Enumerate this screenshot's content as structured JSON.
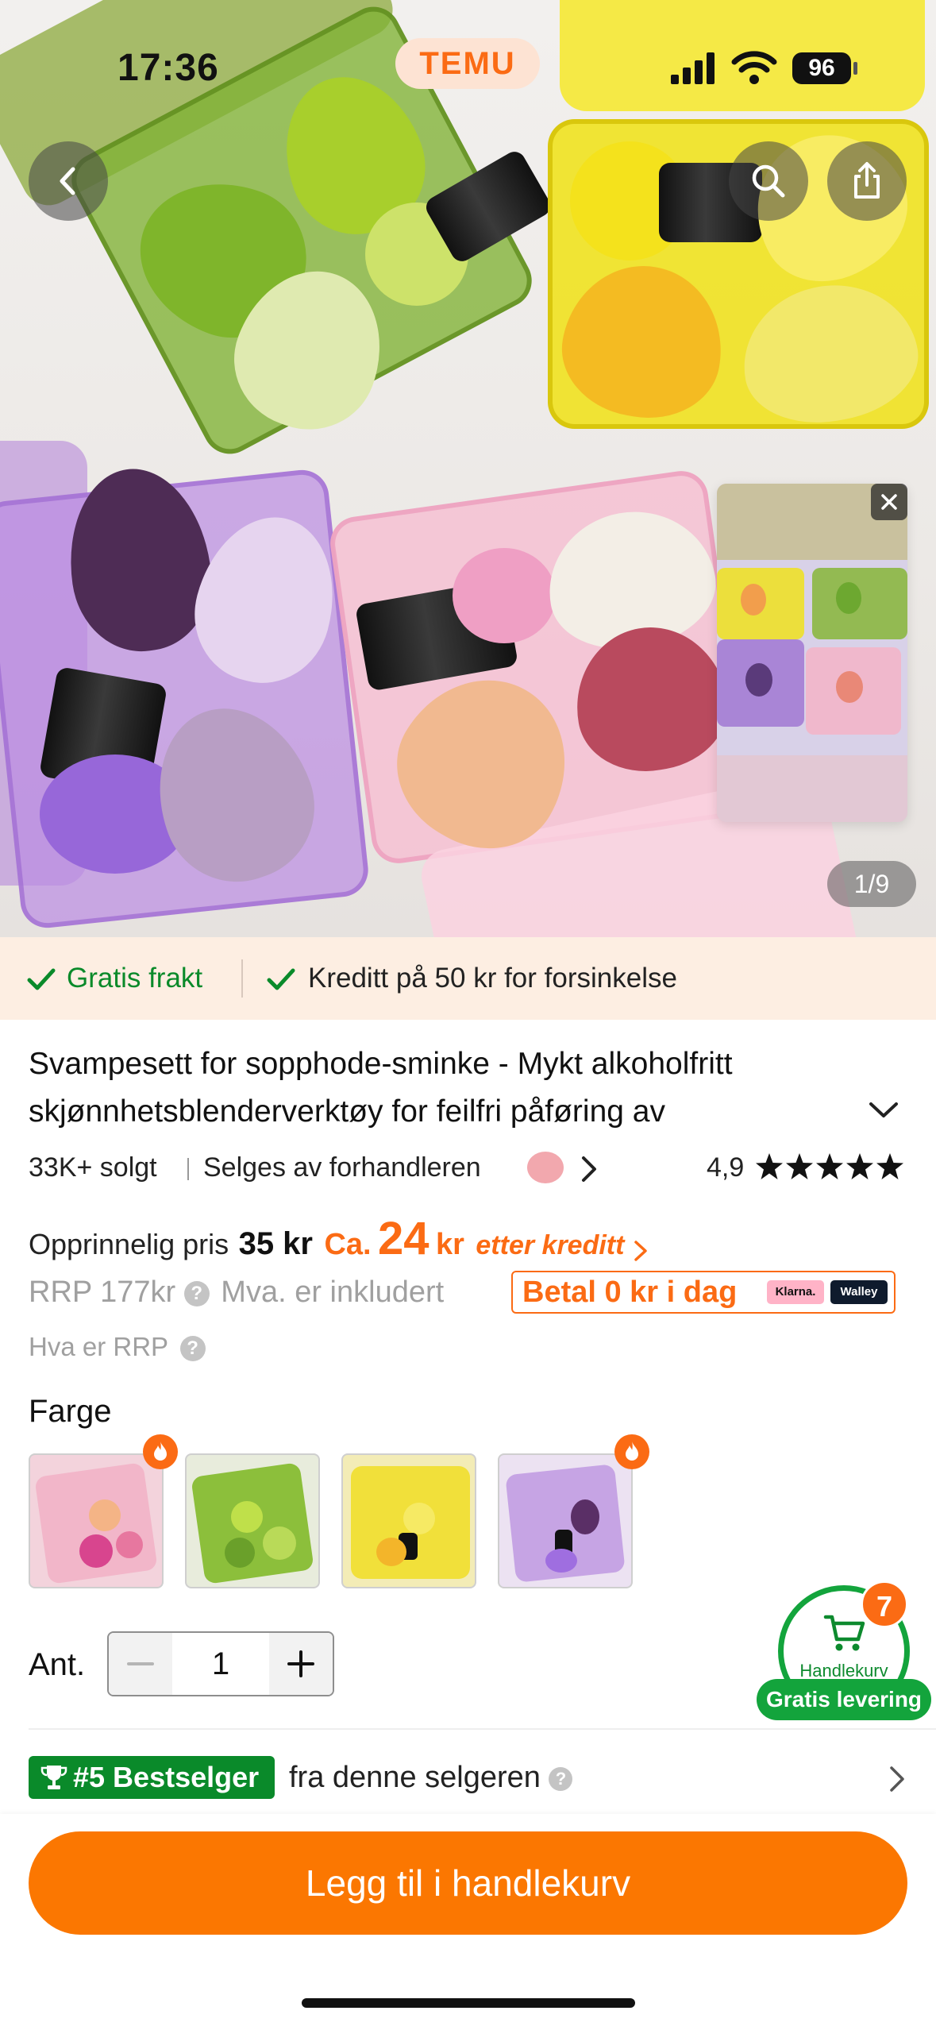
{
  "status_bar": {
    "time": "17:36",
    "app_badge": "TEMU",
    "battery": "96"
  },
  "gallery": {
    "counter": "1/9"
  },
  "promo": {
    "free_shipping": "Gratis frakt",
    "credit": "Kreditt på 50 kr for forsinkelse"
  },
  "product": {
    "title": "Svampesett for sopphode-sminke - Mykt alkoholfritt skjønnhetsblenderverktøy for feilfri påføring av",
    "sold": "33K+ solgt",
    "seller": "Selges av forhandleren",
    "rating": "4,9",
    "rating_stars": 5
  },
  "price": {
    "original_label": "Opprinnelig pris",
    "original_value": "35 kr",
    "approx_prefix": "Ca.",
    "approx_number": "24",
    "approx_unit": "kr",
    "after_credit": "etter kreditt",
    "rrp": "RRP 177kr",
    "vat": "Mva. er inkludert",
    "pay_later": "Betal 0 kr i dag",
    "klarna": "Klarna.",
    "walley": "Walley",
    "rrp_question": "Hva er RRP"
  },
  "color": {
    "label": "Farge",
    "options": [
      "pink",
      "green",
      "yellow",
      "purple"
    ]
  },
  "quantity": {
    "label": "Ant.",
    "value": "1"
  },
  "bestseller": {
    "badge": "#5 Bestselger",
    "text": "fra denne selgeren"
  },
  "cart": {
    "count": "7",
    "label": "Handlekurv",
    "free_delivery": "Gratis levering"
  },
  "cta": {
    "add_to_cart": "Legg til i handlekurv"
  },
  "colors": {
    "accent": "#fb7701",
    "green": "#0a8a2a",
    "promo_bg": "#fdeee2"
  }
}
